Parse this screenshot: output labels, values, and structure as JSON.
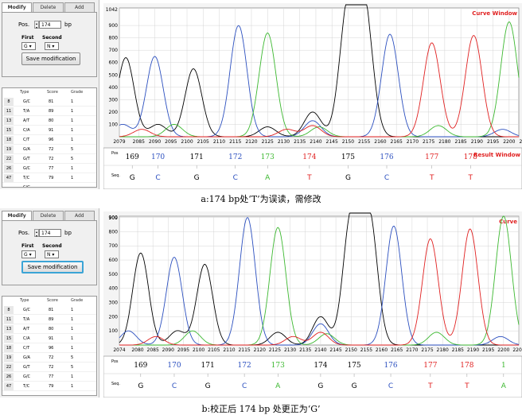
{
  "panels": [
    {
      "id": "a",
      "tabs": [
        "Modify",
        "Delete",
        "Add"
      ],
      "pos_label": "Pos.",
      "pos_value": "174",
      "pos_unit": "bp",
      "first_label": "First",
      "first_value": "G",
      "second_label": "Second",
      "second_value": "N",
      "button_label": "Save modification",
      "table_headers": [
        "Type",
        "Score",
        "Grade"
      ],
      "table_rows": [
        [
          "8",
          "G/C",
          "81",
          "1"
        ],
        [
          "11",
          "T/A",
          "89",
          "1"
        ],
        [
          "13",
          "A/T",
          "80",
          "1"
        ],
        [
          "15",
          "C/A",
          "91",
          "1"
        ],
        [
          "18",
          "C/T",
          "96",
          "1"
        ],
        [
          "19",
          "G/A",
          "72",
          "5"
        ],
        [
          "22",
          "G/T",
          "72",
          "5"
        ],
        [
          "26",
          "G/C",
          "77",
          "1"
        ],
        [
          "47",
          "T/C",
          "79",
          "1"
        ],
        [
          "",
          "C/G",
          "",
          ""
        ]
      ],
      "chart_data": {
        "type": "line",
        "title": "Curve Window",
        "result_title": "Result Window",
        "y_top_label": "1042",
        "yticks": [
          100,
          200,
          300,
          400,
          500,
          600,
          700,
          800,
          900
        ],
        "ylim": [
          0,
          1042
        ],
        "xlim": [
          2079,
          2203
        ],
        "xticks": [
          2079,
          2085,
          2090,
          2095,
          2100,
          2105,
          2110,
          2115,
          2120,
          2125,
          2130,
          2135,
          2140,
          2145,
          2150,
          2155,
          2160,
          2165,
          2170,
          2175,
          2180,
          2185,
          2190,
          2195,
          2200,
          2205
        ],
        "pos_label": "Pos",
        "seq_label": "Seq.",
        "positions": [
          {
            "label": "169",
            "x": 2083,
            "color": "#000000"
          },
          {
            "label": "170",
            "x": 2091,
            "color": "#2b4fbf"
          },
          {
            "label": "171",
            "x": 2103,
            "color": "#000000"
          },
          {
            "label": "172",
            "x": 2115,
            "color": "#2b4fbf"
          },
          {
            "label": "173",
            "x": 2125,
            "color": "#3cb830"
          },
          {
            "label": "174",
            "x": 2138,
            "color": "#e02020"
          },
          {
            "label": "175",
            "x": 2150,
            "color": "#000000"
          },
          {
            "label": "176",
            "x": 2162,
            "color": "#2b4fbf"
          },
          {
            "label": "177",
            "x": 2176,
            "color": "#e02020"
          },
          {
            "label": "178",
            "x": 2188,
            "color": "#e02020"
          }
        ],
        "bases": [
          {
            "label": "G",
            "x": 2083,
            "color": "#000000"
          },
          {
            "label": "C",
            "x": 2091,
            "color": "#2b4fbf"
          },
          {
            "label": "G",
            "x": 2103,
            "color": "#000000"
          },
          {
            "label": "C",
            "x": 2115,
            "color": "#2b4fbf"
          },
          {
            "label": "A",
            "x": 2125,
            "color": "#3cb830"
          },
          {
            "label": "T",
            "x": 2138,
            "color": "#e02020"
          },
          {
            "label": "G",
            "x": 2150,
            "color": "#000000"
          },
          {
            "label": "C",
            "x": 2162,
            "color": "#2b4fbf"
          },
          {
            "label": "T",
            "x": 2176,
            "color": "#e02020"
          },
          {
            "label": "T",
            "x": 2188,
            "color": "#e02020"
          }
        ],
        "series": [
          {
            "color": "#000000",
            "peaks": [
              [
                2081,
                640
              ],
              [
                2102,
                550
              ],
              [
                2139,
                200
              ],
              [
                2150,
                1042
              ],
              [
                2155,
                1042
              ],
              [
                2091,
                100
              ],
              [
                2125,
                80
              ]
            ]
          },
          {
            "color": "#2b4fbf",
            "peaks": [
              [
                2090,
                650
              ],
              [
                2116,
                900
              ],
              [
                2163,
                830
              ],
              [
                2080,
                100
              ],
              [
                2139,
                130
              ],
              [
                2198,
                60
              ]
            ]
          },
          {
            "color": "#3cb830",
            "peaks": [
              [
                2125,
                840
              ],
              [
                2200,
                930
              ],
              [
                2096,
                100
              ],
              [
                2141,
                80
              ],
              [
                2178,
                90
              ]
            ]
          },
          {
            "color": "#e02020",
            "peaks": [
              [
                2176,
                760
              ],
              [
                2189,
                820
              ],
              [
                2086,
                60
              ],
              [
                2131,
                60
              ],
              [
                2139,
                90
              ]
            ]
          }
        ]
      }
    },
    {
      "id": "b",
      "tabs": [
        "Modify",
        "Delete",
        "Add"
      ],
      "pos_label": "Pos.",
      "pos_value": "174",
      "pos_unit": "bp",
      "first_label": "First",
      "first_value": "G",
      "second_label": "Second",
      "second_value": "N",
      "button_label": "Save modification",
      "table_headers": [
        "Type",
        "Score",
        "Grade"
      ],
      "table_rows": [
        [
          "8",
          "G/C",
          "81",
          "1"
        ],
        [
          "11",
          "T/A",
          "89",
          "1"
        ],
        [
          "13",
          "A/T",
          "80",
          "1"
        ],
        [
          "15",
          "C/A",
          "91",
          "1"
        ],
        [
          "18",
          "C/T",
          "96",
          "1"
        ],
        [
          "19",
          "G/A",
          "72",
          "5"
        ],
        [
          "22",
          "G/T",
          "72",
          "5"
        ],
        [
          "26",
          "G/C",
          "77",
          "1"
        ],
        [
          "47",
          "T/C",
          "79",
          "1"
        ]
      ],
      "chart_data": {
        "type": "line",
        "title": "Curve",
        "result_title": "",
        "y_top_label": "909",
        "yticks": [
          100,
          200,
          300,
          400,
          500,
          600,
          700,
          800,
          900
        ],
        "ylim": [
          0,
          909
        ],
        "xlim": [
          2074,
          2205
        ],
        "xticks": [
          2074,
          2080,
          2085,
          2090,
          2095,
          2100,
          2105,
          2110,
          2115,
          2120,
          2125,
          2130,
          2135,
          2140,
          2145,
          2150,
          2155,
          2160,
          2165,
          2170,
          2175,
          2180,
          2185,
          2190,
          2195,
          2200,
          2205
        ],
        "pos_label": "Pos",
        "seq_label": "Seq.",
        "positions": [
          {
            "label": "169",
            "x": 2081,
            "color": "#000000"
          },
          {
            "label": "170",
            "x": 2092,
            "color": "#2b4fbf"
          },
          {
            "label": "171",
            "x": 2103,
            "color": "#000000"
          },
          {
            "label": "172",
            "x": 2115,
            "color": "#2b4fbf"
          },
          {
            "label": "173",
            "x": 2126,
            "color": "#3cb830"
          },
          {
            "label": "174",
            "x": 2140,
            "color": "#000000"
          },
          {
            "label": "175",
            "x": 2151,
            "color": "#000000"
          },
          {
            "label": "176",
            "x": 2163,
            "color": "#2b4fbf"
          },
          {
            "label": "177",
            "x": 2176,
            "color": "#e02020"
          },
          {
            "label": "178",
            "x": 2188,
            "color": "#e02020"
          },
          {
            "label": "1",
            "x": 2200,
            "color": "#3cb830"
          }
        ],
        "bases": [
          {
            "label": "G",
            "x": 2081,
            "color": "#000000"
          },
          {
            "label": "C",
            "x": 2092,
            "color": "#2b4fbf"
          },
          {
            "label": "G",
            "x": 2103,
            "color": "#000000"
          },
          {
            "label": "C",
            "x": 2115,
            "color": "#2b4fbf"
          },
          {
            "label": "A",
            "x": 2126,
            "color": "#3cb830"
          },
          {
            "label": "G",
            "x": 2140,
            "color": "#000000"
          },
          {
            "label": "G",
            "x": 2151,
            "color": "#000000"
          },
          {
            "label": "C",
            "x": 2163,
            "color": "#2b4fbf"
          },
          {
            "label": "T",
            "x": 2176,
            "color": "#e02020"
          },
          {
            "label": "T",
            "x": 2188,
            "color": "#e02020"
          },
          {
            "label": "A",
            "x": 2200,
            "color": "#3cb830"
          }
        ],
        "series": [
          {
            "color": "#000000",
            "peaks": [
              [
                2081,
                650
              ],
              [
                2102,
                570
              ],
              [
                2140,
                200
              ],
              [
                2150,
                909
              ],
              [
                2156,
                909
              ],
              [
                2093,
                100
              ],
              [
                2126,
                90
              ]
            ]
          },
          {
            "color": "#2b4fbf",
            "peaks": [
              [
                2092,
                620
              ],
              [
                2116,
                900
              ],
              [
                2164,
                840
              ],
              [
                2077,
                100
              ],
              [
                2140,
                150
              ],
              [
                2199,
                60
              ]
            ]
          },
          {
            "color": "#3cb830",
            "peaks": [
              [
                2126,
                830
              ],
              [
                2200,
                910
              ],
              [
                2098,
                100
              ],
              [
                2142,
                80
              ],
              [
                2178,
                90
              ]
            ]
          },
          {
            "color": "#e02020",
            "peaks": [
              [
                2176,
                750
              ],
              [
                2189,
                820
              ],
              [
                2086,
                60
              ],
              [
                2131,
                60
              ],
              [
                2140,
                90
              ]
            ]
          }
        ]
      }
    }
  ],
  "captions": {
    "a": "a:174 bp处‘T’为误读，需修改",
    "b": "b:校正后 174 bp 处更正为‘G’"
  }
}
